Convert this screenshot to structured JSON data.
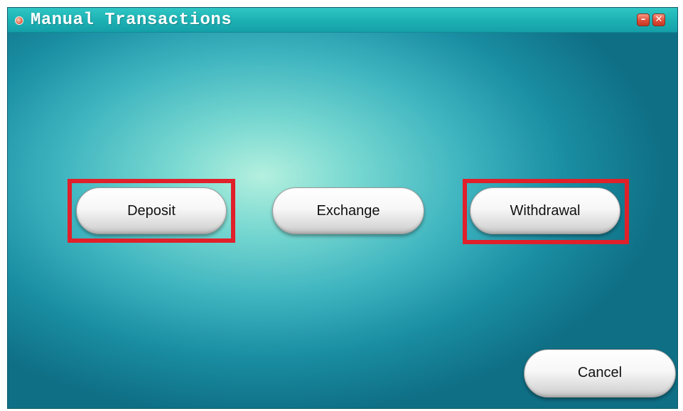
{
  "window": {
    "title": "Manual Transactions",
    "minimize_symbol": "–",
    "close_symbol": "✕"
  },
  "actions": {
    "deposit_label": "Deposit",
    "exchange_label": "Exchange",
    "withdrawal_label": "Withdrawal",
    "cancel_label": "Cancel"
  },
  "icons": {
    "title_icon": "app-dot-icon",
    "minimize_icon": "minimize-icon",
    "close_icon": "close-icon"
  },
  "colors": {
    "highlight": "#e0202a",
    "titlebar": "#1db0b3",
    "background_center": "#b4f0df",
    "background_edge": "#0f6f85"
  }
}
